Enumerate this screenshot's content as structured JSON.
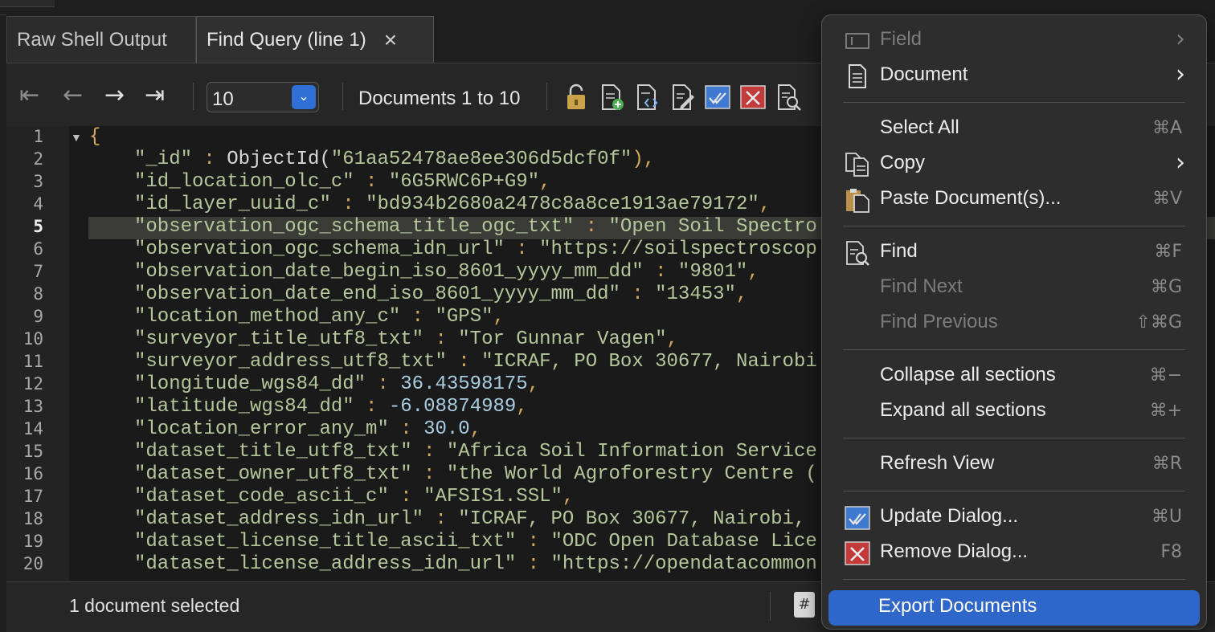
{
  "tabs": [
    {
      "label": "Raw Shell Output"
    },
    {
      "label": "Find Query (line 1)",
      "close": "×"
    }
  ],
  "toolbar": {
    "page_size": "10",
    "documents_label": "Documents 1 to 10"
  },
  "editor": {
    "line_numbers": [
      "1",
      "2",
      "3",
      "4",
      "5",
      "6",
      "7",
      "8",
      "9",
      "10",
      "11",
      "12",
      "13",
      "14",
      "15",
      "16",
      "17",
      "18",
      "19",
      "20"
    ],
    "current_line": "5",
    "open_brace": "{",
    "lines": [
      {
        "key": "\"_id\"",
        "sep": " : ",
        "func": "ObjectId(",
        "value": "\"61aa52478ae8ee306d5dcf0f\"",
        "close": ")",
        "end": ","
      },
      {
        "key": "\"id_location_olc_c\"",
        "sep": " : ",
        "value": "\"6G5RWC6P+G9\"",
        "end": ","
      },
      {
        "key": "\"id_layer_uuid_c\"",
        "sep": " : ",
        "value": "\"bd934b2680a2478c8a8ce1913ae79172\"",
        "end": ","
      },
      {
        "key": "\"observation_ogc_schema_title_ogc_txt\"",
        "sep": " : ",
        "value": "\"Open Soil Spectro",
        "end": ""
      },
      {
        "key": "\"observation_ogc_schema_idn_url\"",
        "sep": " : ",
        "value": "\"https://soilspectroscop",
        "end": ""
      },
      {
        "key": "\"observation_date_begin_iso_8601_yyyy_mm_dd\"",
        "sep": " : ",
        "value": "\"9801\"",
        "end": ","
      },
      {
        "key": "\"observation_date_end_iso_8601_yyyy_mm_dd\"",
        "sep": " : ",
        "value": "\"13453\"",
        "end": ","
      },
      {
        "key": "\"location_method_any_c\"",
        "sep": " : ",
        "value": "\"GPS\"",
        "end": ","
      },
      {
        "key": "\"surveyor_title_utf8_txt\"",
        "sep": " : ",
        "value": "\"Tor Gunnar Vagen\"",
        "end": ","
      },
      {
        "key": "\"surveyor_address_utf8_txt\"",
        "sep": " : ",
        "value": "\"ICRAF, PO Box 30677, Nairobi",
        "end": ""
      },
      {
        "key": "\"longitude_wgs84_dd\"",
        "sep": " : ",
        "num": "36.43598175",
        "end": ","
      },
      {
        "key": "\"latitude_wgs84_dd\"",
        "sep": " : ",
        "num": "-6.08874989",
        "end": ","
      },
      {
        "key": "\"location_error_any_m\"",
        "sep": " : ",
        "num": "30.0",
        "end": ","
      },
      {
        "key": "\"dataset_title_utf8_txt\"",
        "sep": " : ",
        "value": "\"Africa Soil Information Service",
        "end": ""
      },
      {
        "key": "\"dataset_owner_utf8_txt\"",
        "sep": " : ",
        "value": "\"the World Agroforestry Centre (",
        "end": ""
      },
      {
        "key": "\"dataset_code_ascii_c\"",
        "sep": " : ",
        "value": "\"AFSIS1.SSL\"",
        "end": ","
      },
      {
        "key": "\"dataset_address_idn_url\"",
        "sep": " : ",
        "value": "\"ICRAF, PO Box 30677, Nairobi,",
        "end": ""
      },
      {
        "key": "\"dataset_license_title_ascii_txt\"",
        "sep": " : ",
        "value": "\"ODC Open Database Lice",
        "end": ""
      },
      {
        "key": "\"dataset_license_address_idn_url\"",
        "sep": " : ",
        "value": "\"https://opendatacommon",
        "end": ""
      }
    ]
  },
  "status": {
    "selected_text": "1 document selected",
    "icon_glyph": "#"
  },
  "context_menu": {
    "items": [
      {
        "label": "Field",
        "shortcut": "",
        "submenu": "›",
        "disabled": true,
        "icon": "field-icon"
      },
      {
        "label": "Document",
        "shortcut": "",
        "submenu": "›",
        "disabled": false,
        "icon": "document-icon"
      },
      {
        "label": "Select All",
        "shortcut": "⌘A",
        "disabled": false,
        "icon": ""
      },
      {
        "label": "Copy",
        "shortcut": "",
        "submenu": "›",
        "disabled": false,
        "icon": "copy-icon"
      },
      {
        "label": "Paste Document(s)...",
        "shortcut": "⌘V",
        "disabled": false,
        "icon": "paste-icon"
      },
      {
        "label": "Find",
        "shortcut": "⌘F",
        "disabled": false,
        "icon": "find-icon"
      },
      {
        "label": "Find Next",
        "shortcut": "⌘G",
        "disabled": true,
        "icon": ""
      },
      {
        "label": "Find Previous",
        "shortcut": "⇧⌘G",
        "disabled": true,
        "icon": ""
      },
      {
        "label": "Collapse all sections",
        "shortcut": "⌘−",
        "disabled": false,
        "icon": ""
      },
      {
        "label": "Expand all sections",
        "shortcut": "⌘+",
        "disabled": false,
        "icon": ""
      },
      {
        "label": "Refresh View",
        "shortcut": "⌘R",
        "disabled": false,
        "icon": ""
      },
      {
        "label": "Update Dialog...",
        "shortcut": "⌘U",
        "disabled": false,
        "icon": "update-icon"
      },
      {
        "label": "Remove Dialog...",
        "shortcut": "F8",
        "disabled": false,
        "icon": "remove-icon"
      },
      {
        "label": "Export Documents",
        "shortcut": "",
        "disabled": false,
        "selected": true,
        "icon": ""
      }
    ]
  },
  "colors": {
    "menu_highlight": "#2f66c9",
    "select_arrow": "#2f6fd6",
    "string_green": "#b5c79a",
    "punct_orange": "#d6a85c",
    "number_blue": "#a9cde0"
  }
}
